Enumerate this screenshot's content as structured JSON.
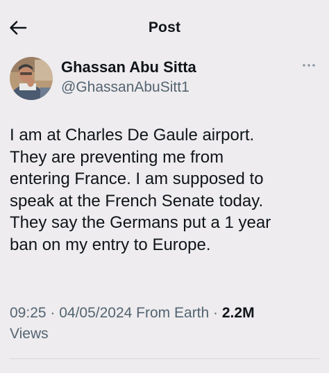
{
  "header": {
    "title": "Post",
    "back_icon": "arrow-left-icon"
  },
  "author": {
    "display_name": "Ghassan Abu Sitta",
    "handle": "@GhassanAbuSitt1",
    "avatar_icon": "avatar-photo",
    "more_icon": "more-horizontal-icon"
  },
  "tweet": {
    "text": "I am at Charles De Gaule airport.\nThey are preventing me from\nentering France. I am supposed to\nspeak at the French Senate today.\nThey say the Germans put a 1 year\nban on my entry to Europe."
  },
  "meta": {
    "time": "09:25",
    "sep1": " · ",
    "date": "04/05/2024",
    "source": " From Earth",
    "sep2": " · ",
    "views_count": "2.2M",
    "views_label": "Views"
  },
  "colors": {
    "background": "#eeecee",
    "text": "#0f1419",
    "secondary": "#536471"
  }
}
